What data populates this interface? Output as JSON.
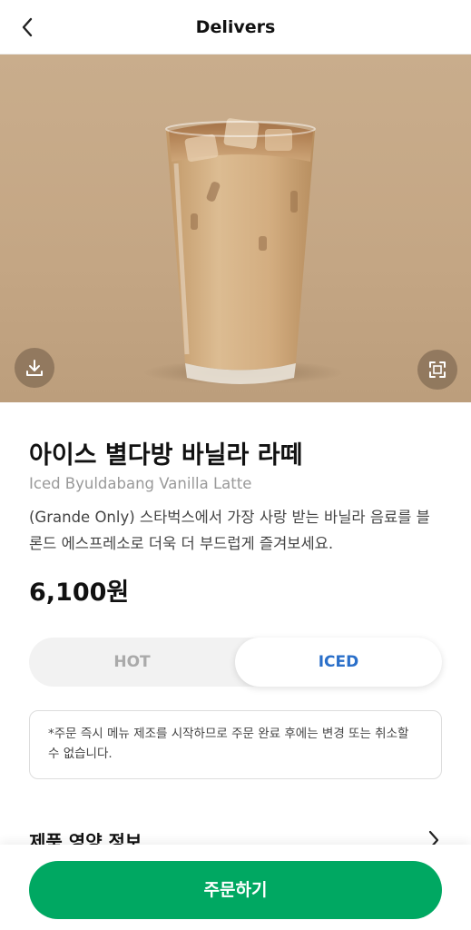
{
  "header": {
    "title": "Delivers",
    "back_icon": "chevron-left-icon"
  },
  "hero": {
    "image": "iced-latte-glass",
    "download_icon": "download-icon",
    "expand_icon": "expand-icon",
    "background_color": "#c6a886"
  },
  "product": {
    "name_ko": "아이스 별다방 바닐라 라떼",
    "name_en": "Iced Byuldabang Vanilla Latte",
    "description": "(Grande Only) 스타벅스에서 가장 사랑 받는 바닐라 음료를 블론드 에스프레소로 더욱 더 부드럽게 즐겨보세요.",
    "price": "6,100원"
  },
  "temperature": {
    "hot_label": "HOT",
    "iced_label": "ICED",
    "selected": "ICED",
    "selected_color": "#2a6fc9"
  },
  "notice": {
    "text": "*주문 즉시 메뉴 제조를 시작하므로 주문 완료 후에는 변경 또는 취소할 수 없습니다."
  },
  "nutrition": {
    "label": "제품 영양 정보",
    "icon": "chevron-right-icon"
  },
  "order_button": {
    "label": "주문하기",
    "color": "#00a862"
  }
}
